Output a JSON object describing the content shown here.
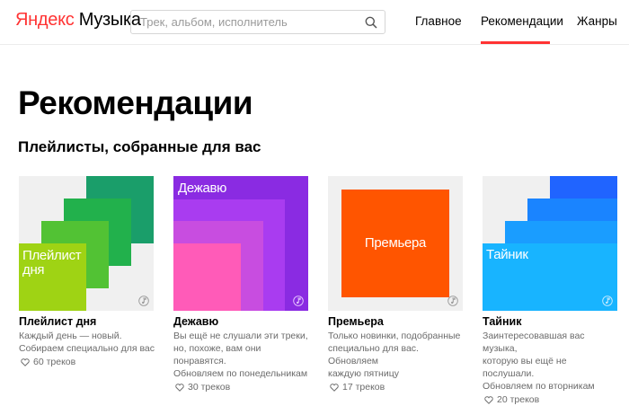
{
  "header": {
    "logo_part1": "Яндекс",
    "logo_part2": "Музыка",
    "search": {
      "placeholder": "Трек, альбом, исполнитель",
      "value": ""
    },
    "nav": [
      {
        "label": "Главное"
      },
      {
        "label": "Рекомендации",
        "active": true
      },
      {
        "label": "Жанры"
      }
    ]
  },
  "main": {
    "page_title": "Рекомендации",
    "section_title": "Плейлисты, собранные для вас",
    "cards": [
      {
        "cover_text": "Плейлист дня",
        "title": "Плейлист дня",
        "desc_line1": "Каждый день — новый.",
        "desc_line2": "Собираем специально для вас",
        "desc_line3": "",
        "tracks": "60 треков"
      },
      {
        "cover_text": "Дежавю",
        "title": "Дежавю",
        "desc_line1": "Вы ещё не слушали эти треки,",
        "desc_line2": "но, похоже, вам они понравятся.",
        "desc_line3": "Обновляем по понедельникам",
        "tracks": "30 треков"
      },
      {
        "cover_text": "Премьера",
        "title": "Премьера",
        "desc_line1": "Только новинки, подобранные",
        "desc_line2": "специально для вас. Обновляем",
        "desc_line3": "каждую пятницу",
        "tracks": "17 треков"
      },
      {
        "cover_text": "Тайник",
        "title": "Тайник",
        "desc_line1": "Заинтересовавшая вас музыка,",
        "desc_line2": "которую вы ещё не послушали.",
        "desc_line3": "Обновляем по вторникам",
        "tracks": "20 треков"
      }
    ]
  },
  "colors": {
    "accent": "#ff3333",
    "playlist_day": [
      "#1a9e6a",
      "#22b14c",
      "#52c234",
      "#9fd314"
    ],
    "dejavu": [
      "#8a2be2",
      "#a93cf0",
      "#c84de0",
      "#ff5bb8"
    ],
    "premiere": "#ff5500",
    "tainik": [
      "#2064ff",
      "#1a84ff",
      "#1a9dff",
      "#18b4ff"
    ]
  },
  "icons": [
    "search-icon",
    "heart-icon",
    "music-note-icon"
  ]
}
